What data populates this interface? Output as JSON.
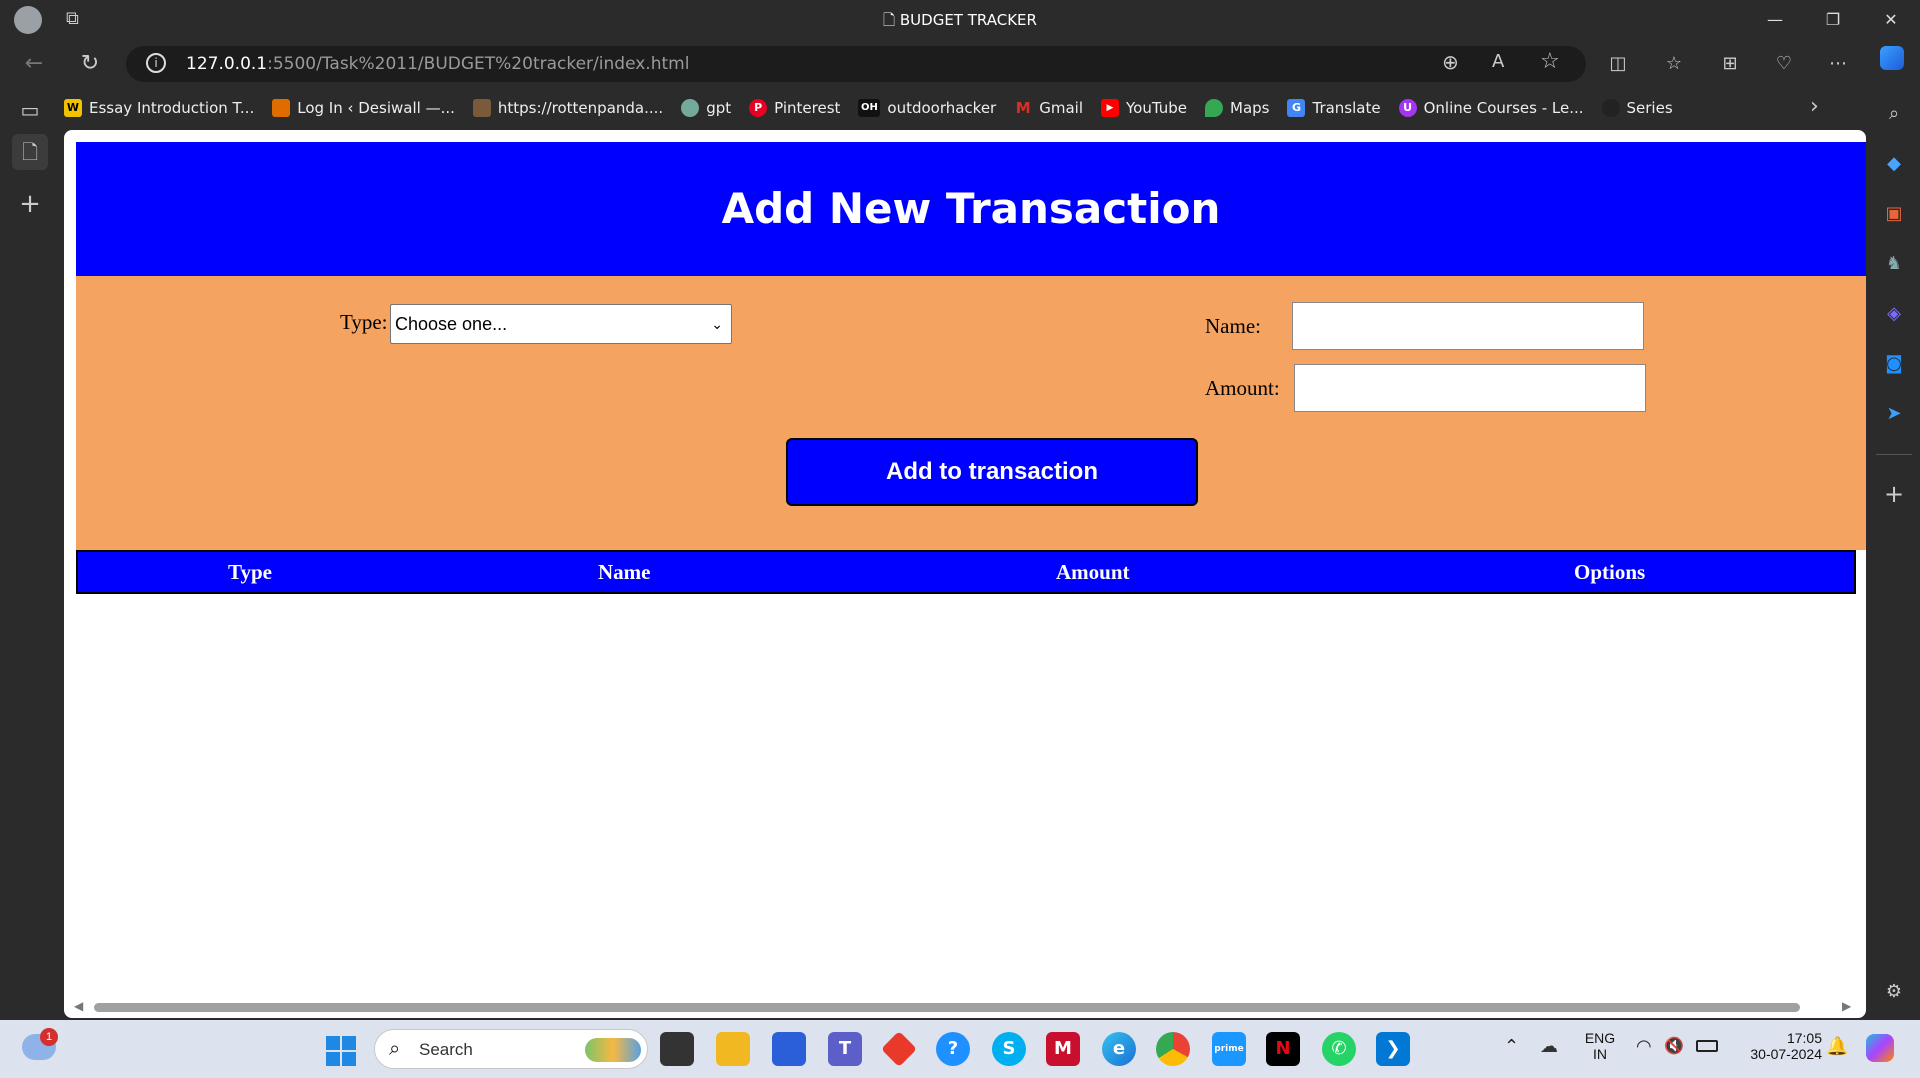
{
  "browser": {
    "window_title": "BUDGET TRACKER",
    "url_host": "127.0.0.1",
    "url_path": ":5500/Task%2011/BUDGET%20tracker/index.html"
  },
  "bookmarks": [
    {
      "label": "Essay Introduction T...",
      "icon": "W",
      "color": "#f2c200"
    },
    {
      "label": "Log In ‹ Desiwall —...",
      "icon": "",
      "color": "#e06c00"
    },
    {
      "label": "https://rottenpanda....",
      "icon": "",
      "color": "#7a5a3a"
    },
    {
      "label": "gpt",
      "icon": "",
      "color": "#74aa9c"
    },
    {
      "label": "Pinterest",
      "icon": "P",
      "color": "#e60023"
    },
    {
      "label": "outdoorhacker",
      "icon": "OH",
      "color": "#111111"
    },
    {
      "label": "Gmail",
      "icon": "M",
      "color": "#d93025"
    },
    {
      "label": "YouTube",
      "icon": "▶",
      "color": "#ff0000"
    },
    {
      "label": "Maps",
      "icon": "",
      "color": "#34a853"
    },
    {
      "label": "Translate",
      "icon": "G",
      "color": "#4285f4"
    },
    {
      "label": "Online Courses - Le...",
      "icon": "U",
      "color": "#a435f0"
    },
    {
      "label": "Series",
      "icon": "",
      "color": "#222222"
    }
  ],
  "page": {
    "heading": "Add New Transaction",
    "type_label": "Type:",
    "type_select_value": "Choose one...",
    "name_label": "Name:",
    "amount_label": "Amount:",
    "add_button": "Add to transaction",
    "table_headers": [
      "Type",
      "Name",
      "Amount",
      "Options"
    ]
  },
  "taskbar": {
    "search_placeholder": "Search",
    "weather_badge": "1",
    "lang_top": "ENG",
    "lang_bottom": "IN",
    "time": "17:05",
    "date": "30-07-2024"
  },
  "colors": {
    "header_blue": "#0000ff",
    "form_bg": "#f4a460"
  }
}
